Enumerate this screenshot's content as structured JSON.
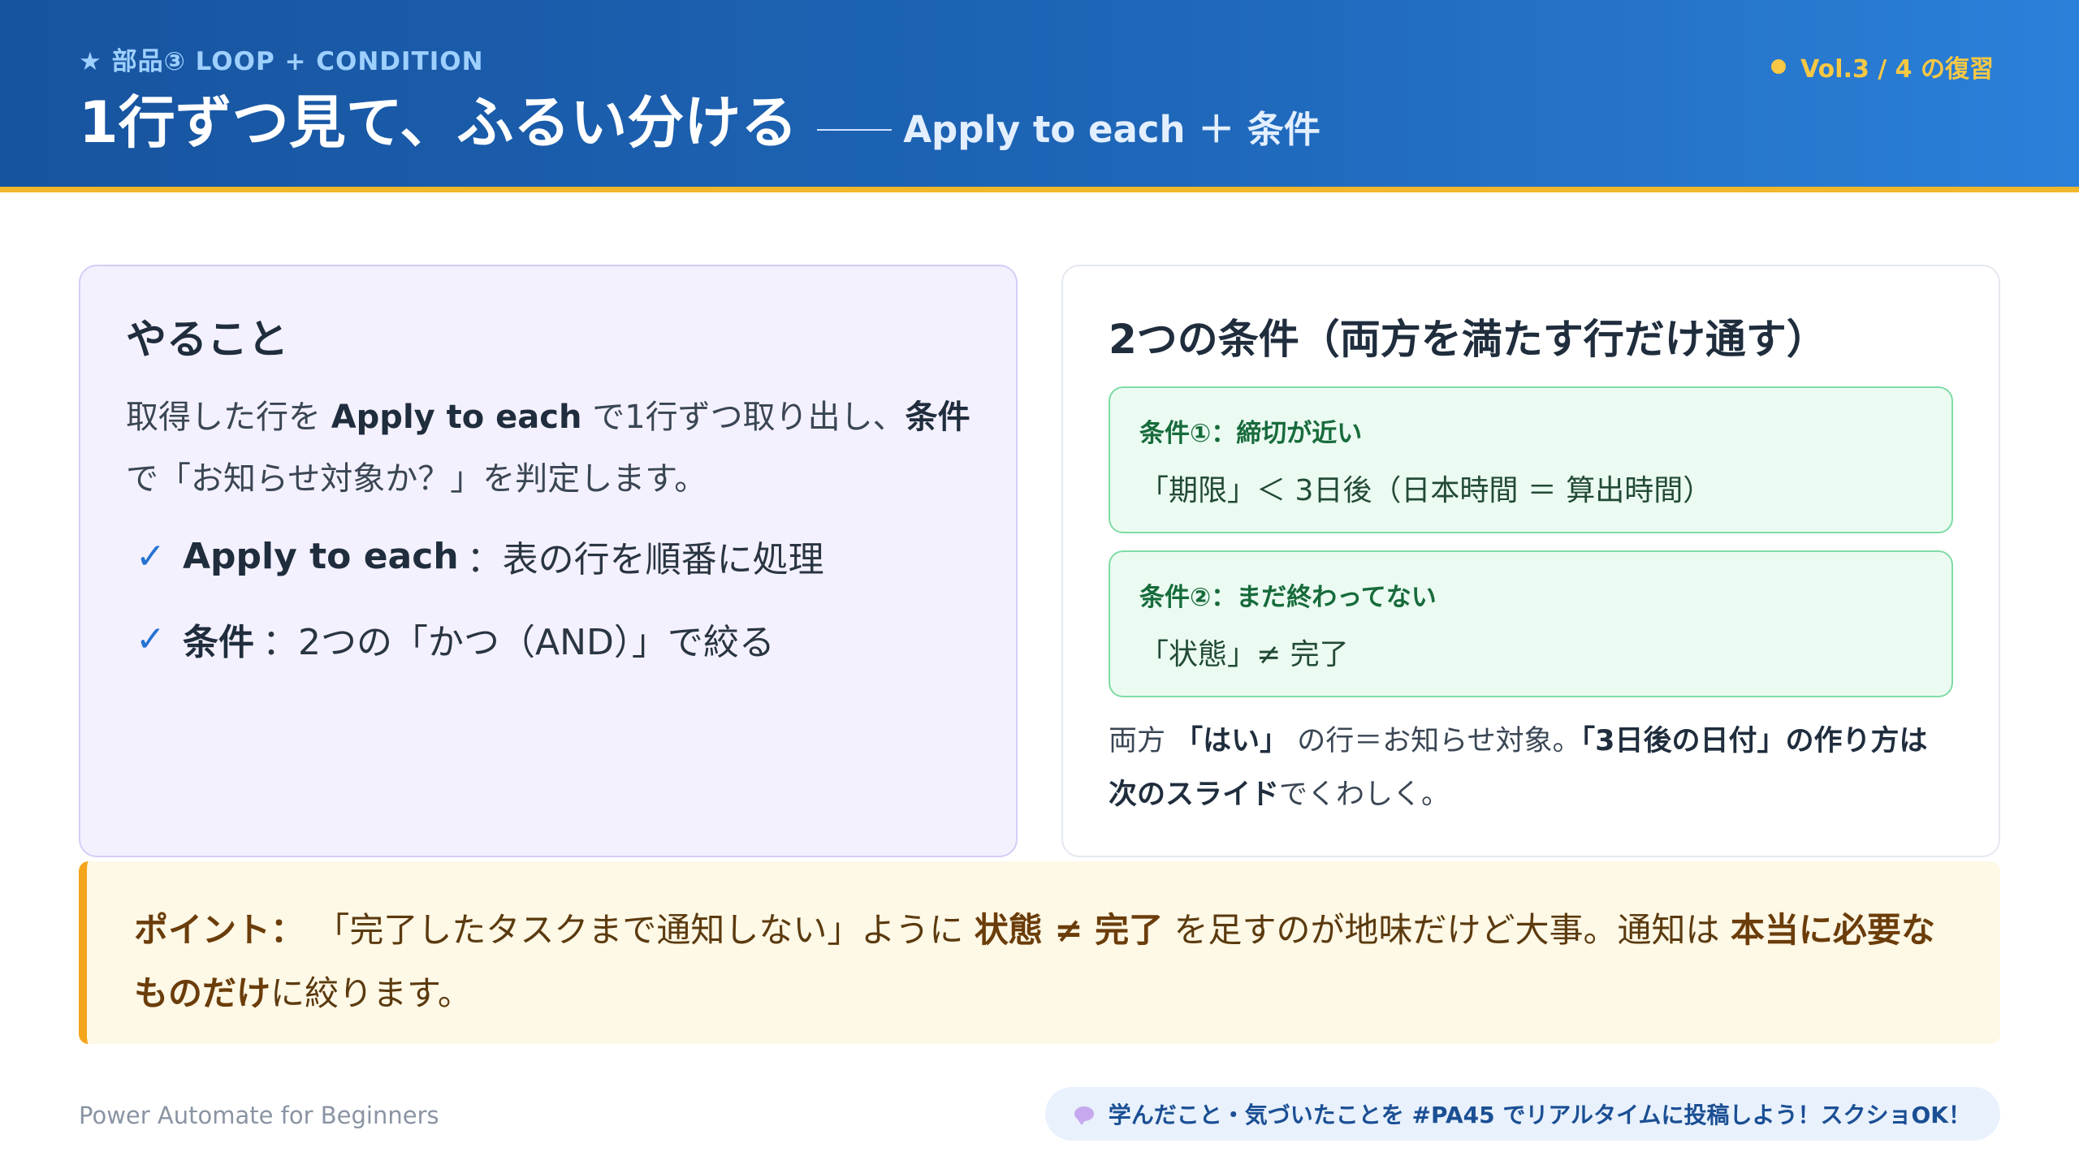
{
  "header": {
    "kicker": "★ 部品③ LOOP + CONDITION",
    "title": "1行ずつ見て、ふるい分ける",
    "subtitle": "Apply to each ＋ 条件",
    "volume": "Vol.3 / 4 の復習",
    "accent_color": "#f2b72a"
  },
  "left_card": {
    "heading": "やること",
    "intro": {
      "part1": "取得した行を ",
      "bold1": "Apply to each",
      "part2": " で1行ずつ取り出し、",
      "bold2": "条件",
      "part3": "で「お知らせ対象か？」を判定します。"
    },
    "checks": [
      {
        "mark": "✓",
        "bold": "Apply to each",
        "text": "：表の行を順番に処理"
      },
      {
        "mark": "✓",
        "bold": "条件",
        "text": "：2つの「かつ（AND）」で絞る"
      }
    ]
  },
  "right_card": {
    "heading": "2つの条件（両方を満たす行だけ通す）",
    "conditions": [
      {
        "label": "条件①：締切が近い",
        "expr": "「期限」＜ 3日後（日本時間 ＝ 算出時間）"
      },
      {
        "label": "条件②：まだ終わってない",
        "expr": "「状態」≠ 完了"
      }
    ],
    "note": {
      "part1": "両方 ",
      "bold1": "「はい」",
      "part2": " の行＝お知らせ対象。",
      "bold2": "「3日後の日付」の作り方は次のスライド",
      "part3": "でくわしく。"
    }
  },
  "point": {
    "label": "ポイント：",
    "part1": " 「完了したタスクまで通知しない」ように ",
    "bold1": "状態 ≠ 完了",
    "part2": " を足すのが地味だけど大事。通知は ",
    "bold2": "本当に必要なものだけ",
    "part3": "に絞ります。"
  },
  "footer": {
    "brand": "Power Automate for Beginners",
    "cta_icon": "speech-bubble-icon",
    "cta": "学んだこと・気づいたことを #PA45 でリアルタイムに投稿しよう！スクショOK！"
  }
}
